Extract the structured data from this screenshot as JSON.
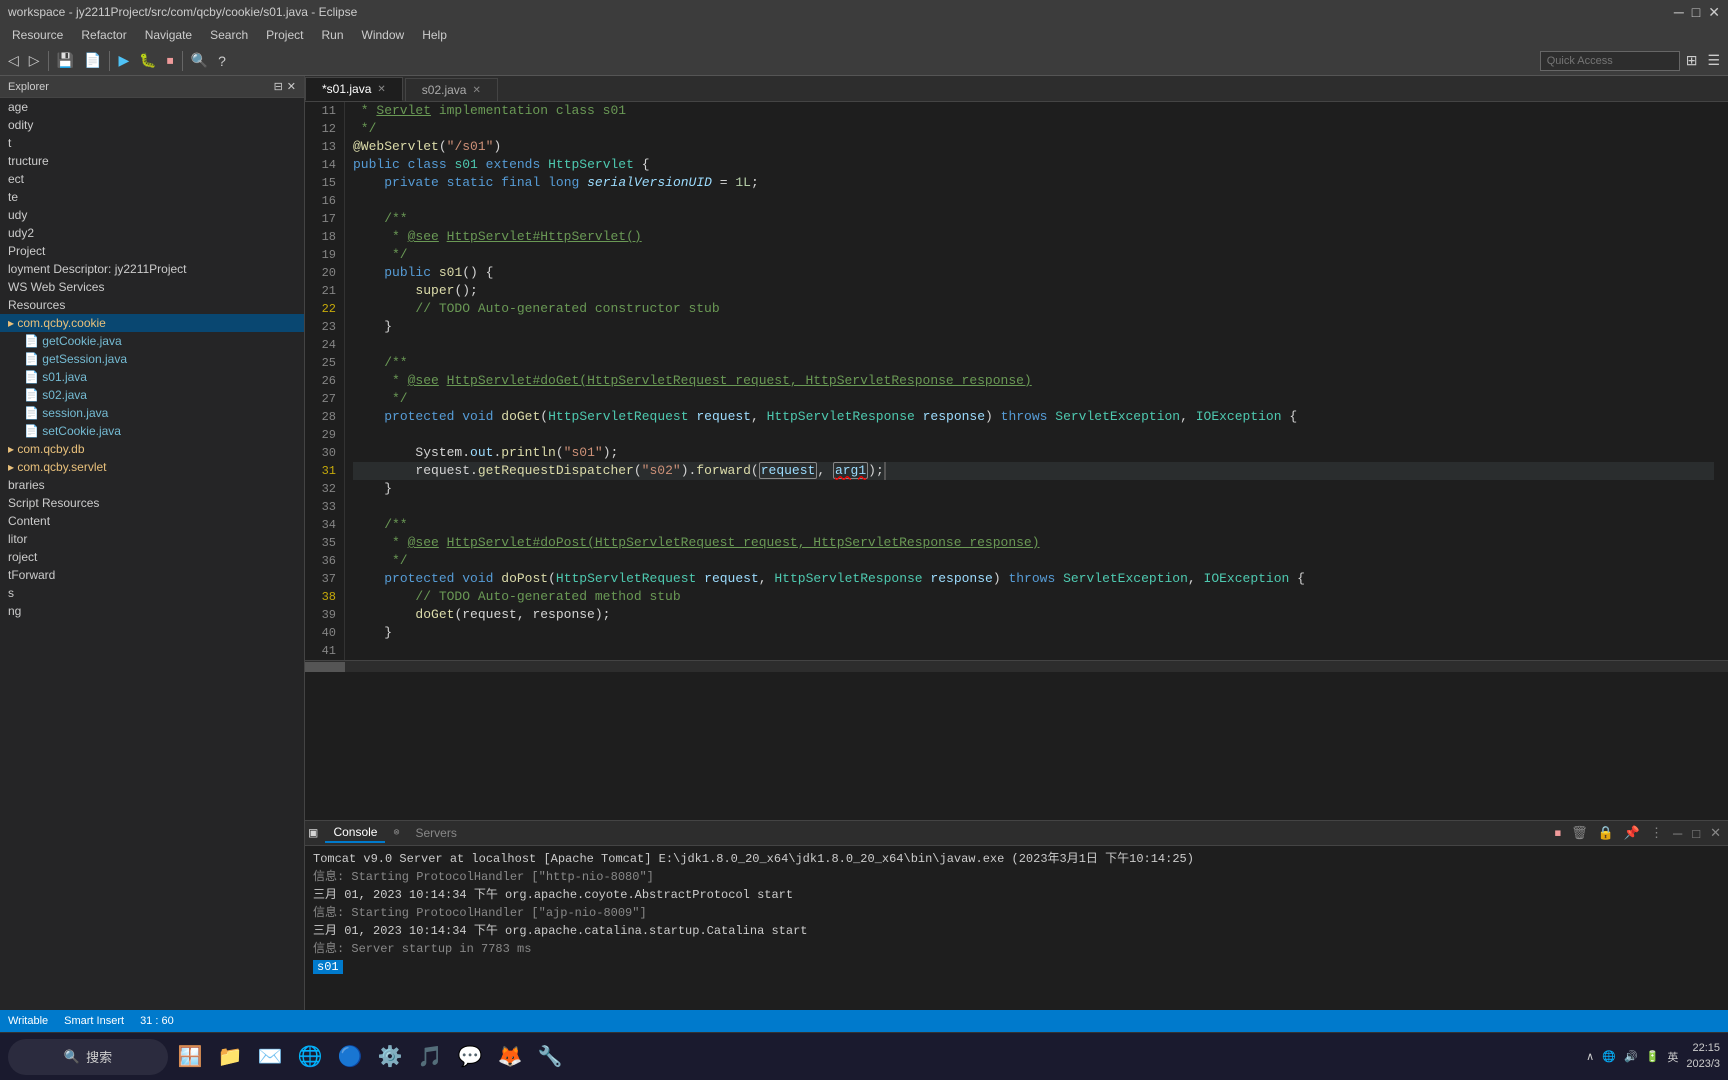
{
  "window": {
    "title": "workspace - jy2211Project/src/com/qcby/cookie/s01.java - Eclipse",
    "controls": [
      "─",
      "□",
      "✕"
    ]
  },
  "menu": {
    "items": [
      "Resource",
      "Refactor",
      "Navigate",
      "Search",
      "Project",
      "Run",
      "Window",
      "Help"
    ]
  },
  "toolbar": {
    "quick_access_placeholder": "Quick Access"
  },
  "sidebar": {
    "title": "Explorer",
    "items": [
      {
        "label": "age",
        "indent": 0
      },
      {
        "label": "odity",
        "indent": 0
      },
      {
        "label": "t",
        "indent": 0
      },
      {
        "label": "tructure",
        "indent": 0
      },
      {
        "label": "ect",
        "indent": 0
      },
      {
        "label": "te",
        "indent": 0
      },
      {
        "label": "udy",
        "indent": 0
      },
      {
        "label": "udy2",
        "indent": 0
      },
      {
        "label": "Project",
        "indent": 0
      },
      {
        "label": "loyment Descriptor: jy2211Project",
        "indent": 0
      },
      {
        "label": "WS Web Services",
        "indent": 0
      },
      {
        "label": "Resources",
        "indent": 0
      },
      {
        "label": "com.qcby.cookie",
        "indent": 0,
        "selected": true
      },
      {
        "label": "getCookie.java",
        "indent": 1
      },
      {
        "label": "getSession.java",
        "indent": 1
      },
      {
        "label": "s01.java",
        "indent": 1
      },
      {
        "label": "s02.java",
        "indent": 1
      },
      {
        "label": "session.java",
        "indent": 1
      },
      {
        "label": "setCookie.java",
        "indent": 1
      },
      {
        "label": "com.qcby.db",
        "indent": 0
      },
      {
        "label": "com.qcby.servlet",
        "indent": 0
      },
      {
        "label": "braries",
        "indent": 0
      },
      {
        "label": "Script Resources",
        "indent": 0
      },
      {
        "label": "Content",
        "indent": 0
      },
      {
        "label": "litor",
        "indent": 0
      },
      {
        "label": "roject",
        "indent": 0
      },
      {
        "label": "tForward",
        "indent": 0
      },
      {
        "label": "s",
        "indent": 0
      },
      {
        "label": "ng",
        "indent": 0
      }
    ]
  },
  "tabs": [
    {
      "label": "*s01.java",
      "active": true
    },
    {
      "label": "s02.java",
      "active": false
    }
  ],
  "code": {
    "lines": [
      {
        "num": 11,
        "content": " * Servlet implementation class s01",
        "type": "comment"
      },
      {
        "num": 12,
        "content": " */",
        "type": "comment"
      },
      {
        "num": 13,
        "content": "@WebServlet(\"/s01\")",
        "type": "annotation"
      },
      {
        "num": 14,
        "content": "public class s01 extends HttpServlet {",
        "type": "code"
      },
      {
        "num": 15,
        "content": "    private static final long serialVersionUID = 1L;",
        "type": "code"
      },
      {
        "num": 16,
        "content": "",
        "type": "blank"
      },
      {
        "num": 17,
        "content": "    /**",
        "type": "comment"
      },
      {
        "num": 18,
        "content": "     * @see HttpServlet#HttpServlet()",
        "type": "comment"
      },
      {
        "num": 19,
        "content": "     */",
        "type": "comment"
      },
      {
        "num": 20,
        "content": "    public s01() {",
        "type": "code"
      },
      {
        "num": 21,
        "content": "        super();",
        "type": "code"
      },
      {
        "num": 22,
        "content": "        // TODO Auto-generated constructor stub",
        "type": "comment",
        "gutter": true
      },
      {
        "num": 23,
        "content": "    }",
        "type": "code"
      },
      {
        "num": 24,
        "content": "",
        "type": "blank"
      },
      {
        "num": 25,
        "content": "    /**",
        "type": "comment"
      },
      {
        "num": 26,
        "content": "     * @see HttpServlet#doGet(HttpServletRequest request, HttpServletResponse response)",
        "type": "comment"
      },
      {
        "num": 27,
        "content": "     */",
        "type": "comment"
      },
      {
        "num": 28,
        "content": "    protected void doGet(HttpServletRequest request, HttpServletResponse response) throws ServletException, IOException {",
        "type": "code"
      },
      {
        "num": 29,
        "content": "",
        "type": "blank"
      },
      {
        "num": 30,
        "content": "        System.out.println(\"s01\");",
        "type": "code"
      },
      {
        "num": 31,
        "content": "        request.getRequestDispatcher(\"s02\").forward(request, arg1);",
        "type": "code",
        "active": true,
        "gutter": true
      },
      {
        "num": 32,
        "content": "    }",
        "type": "code"
      },
      {
        "num": 33,
        "content": "",
        "type": "blank"
      },
      {
        "num": 34,
        "content": "    /**",
        "type": "comment"
      },
      {
        "num": 35,
        "content": "     * @see HttpServlet#doPost(HttpServletRequest request, HttpServletResponse response)",
        "type": "comment"
      },
      {
        "num": 36,
        "content": "     */",
        "type": "comment"
      },
      {
        "num": 37,
        "content": "    protected void doPost(HttpServletRequest request, HttpServletResponse response) throws ServletException, IOException {",
        "type": "code"
      },
      {
        "num": 38,
        "content": "        // TODO Auto-generated method stub",
        "type": "comment",
        "gutter": true
      },
      {
        "num": 39,
        "content": "        doGet(request, response);",
        "type": "code"
      },
      {
        "num": 40,
        "content": "    }",
        "type": "code"
      },
      {
        "num": 41,
        "content": "",
        "type": "blank"
      }
    ]
  },
  "console": {
    "tabs": [
      {
        "label": "Console",
        "active": true
      },
      {
        "label": "Servers",
        "active": false
      }
    ],
    "output": [
      "Tomcat v9.0 Server at localhost [Apache Tomcat] E:\\jdk1.8.0_20_x64\\jdk1.8.0_20_x64\\bin\\javaw.exe (2023年3月1日 下午10:14:25)",
      "信息: Starting ProtocolHandler [\"http-nio-8080\"]",
      "三月 01, 2023 10:14:34 下午 org.apache.coyote.AbstractProtocol start",
      "信息: Starting ProtocolHandler [\"ajp-nio-8009\"]",
      "三月 01, 2023 10:14:34 下午 org.apache.catalina.startup.Catalina start",
      "信息: Server startup in 7783 ms",
      "s01"
    ]
  },
  "status": {
    "writable": "Writable",
    "insert_mode": "Smart Insert",
    "position": "31 : 60"
  },
  "taskbar": {
    "search_label": "搜索",
    "time": "22:15",
    "date": "2023/3"
  }
}
